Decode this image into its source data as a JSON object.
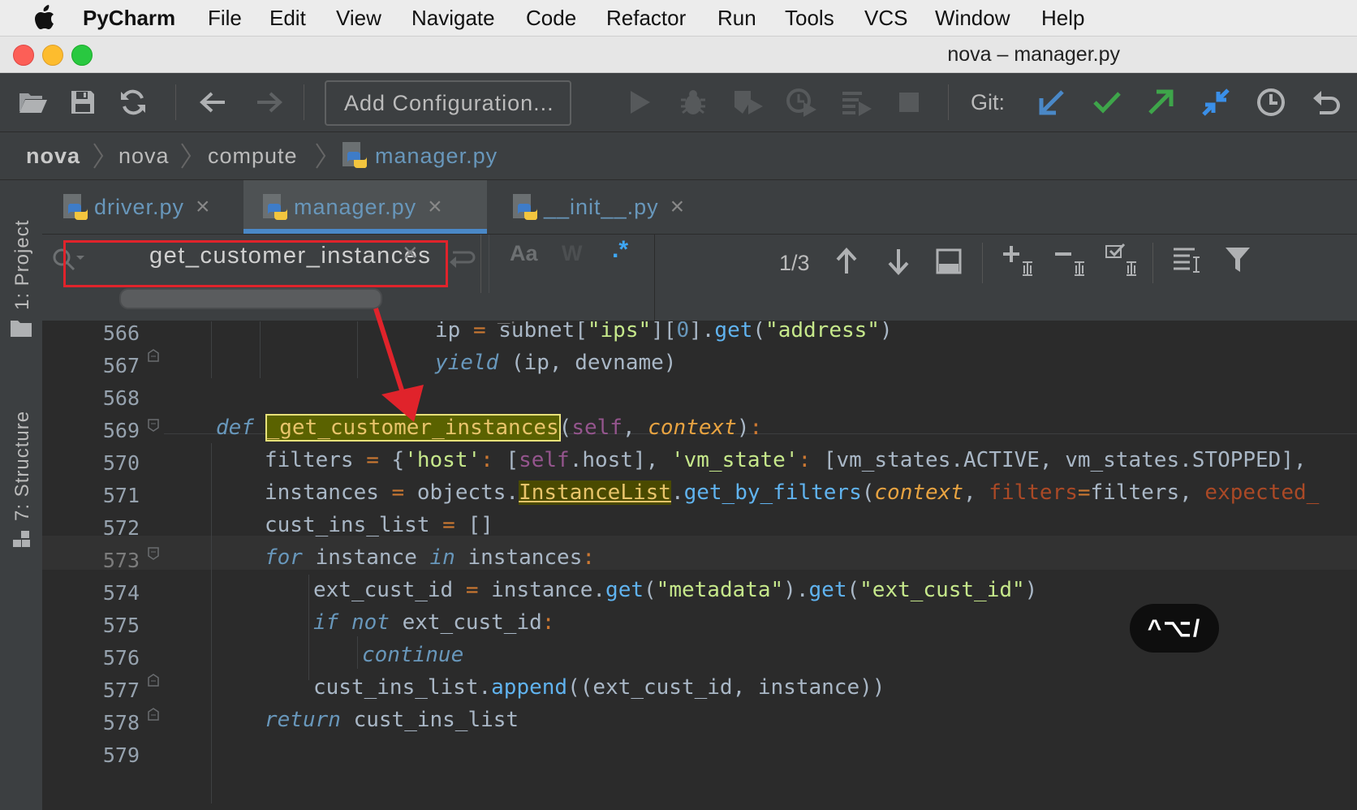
{
  "menubar": {
    "app_name": "PyCharm",
    "items": [
      "File",
      "Edit",
      "View",
      "Navigate",
      "Code",
      "Refactor",
      "Run",
      "Tools",
      "VCS",
      "Window",
      "Help"
    ]
  },
  "window": {
    "title": "nova – manager.py"
  },
  "toolbar": {
    "add_configuration": "Add Configuration...",
    "git_label": "Git:"
  },
  "breadcrumb": [
    "nova",
    "nova",
    "compute",
    "manager.py"
  ],
  "sidebar": {
    "project": "1: Project",
    "structure": "7: Structure"
  },
  "tabs": [
    {
      "label": "driver.py",
      "active": false
    },
    {
      "label": "manager.py",
      "active": true
    },
    {
      "label": "__init__.py",
      "active": false
    }
  ],
  "find": {
    "query": "get_customer_instances",
    "match_case_label": "Aa",
    "words_label": "W",
    "regex_label": ".*",
    "match_count": "1/3"
  },
  "editor": {
    "lines": [
      "566",
      "567",
      "568",
      "569",
      "570",
      "571",
      "572",
      "573",
      "574",
      "575",
      "576",
      "577",
      "578",
      "579"
    ],
    "current_line": "573"
  },
  "shortcut_badge": "^⌥/",
  "colors": {
    "accent_blue": "#4a88c7",
    "git_green": "#3ea54a",
    "highlight_box": "#e0232b",
    "current_line_bg": "#323232",
    "search_hit_bg": "#5a6200"
  }
}
